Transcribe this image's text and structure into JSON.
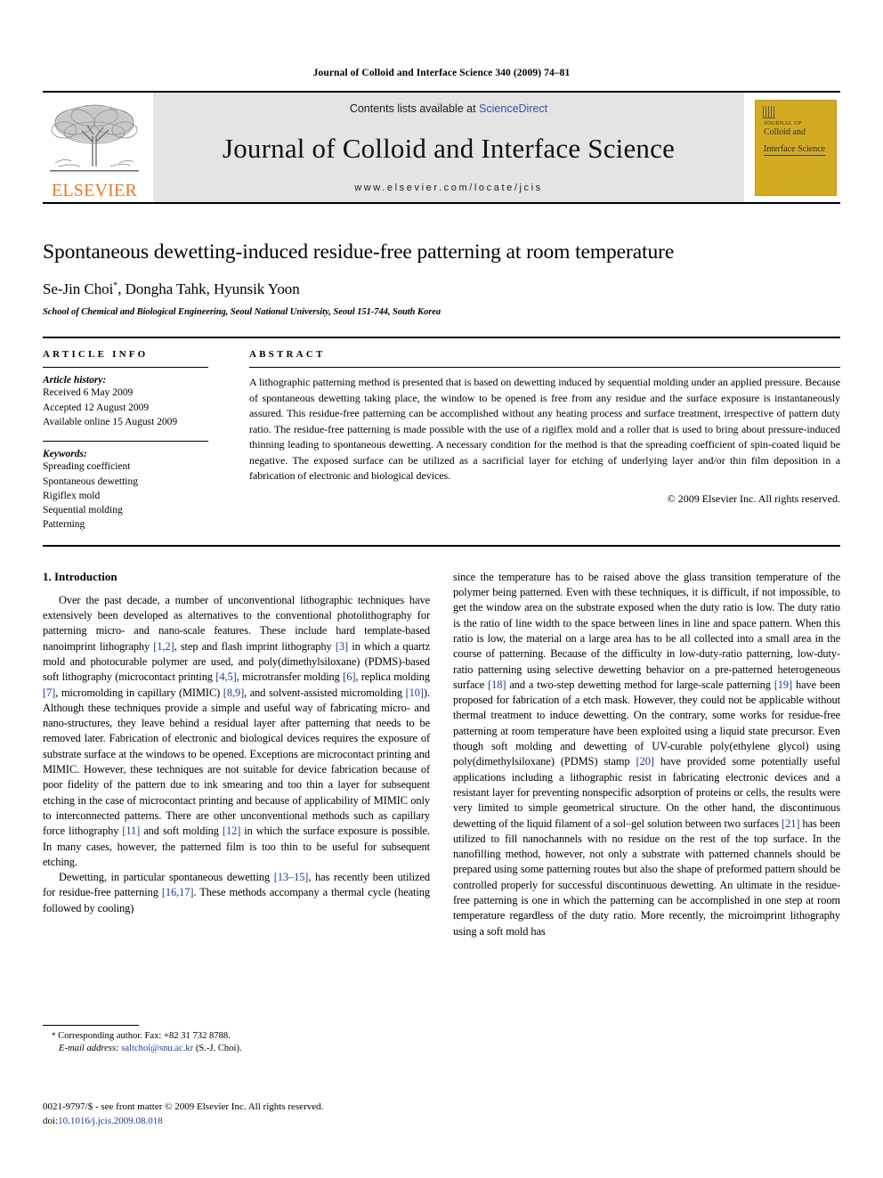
{
  "running_head": "Journal of Colloid and Interface Science 340 (2009) 74–81",
  "masthead": {
    "elsevier_wordmark": "ELSEVIER",
    "contents_prefix": "Contents lists available at ",
    "sciencedirect": "ScienceDirect",
    "journal_title": "Journal of Colloid and Interface Science",
    "journal_url": "www.elsevier.com/locate/jcis",
    "cover": {
      "line1": "JOURNAL OF",
      "line2": "Colloid and",
      "line3": "Interface Science",
      "background_color": "#d3ab22"
    },
    "banner_color": "#e4e4e4",
    "elsevier_orange": "#e87722"
  },
  "article": {
    "title": "Spontaneous dewetting-induced residue-free patterning at room temperature",
    "authors": "Se-Jin Choi",
    "authors_rest": ", Dongha Tahk, Hyunsik Yoon",
    "corresponding_marker": "*",
    "affiliation": "School of Chemical and Biological Engineering, Seoul National University, Seoul 151-744, South Korea"
  },
  "article_info": {
    "label": "ARTICLE INFO",
    "history_label": "Article history:",
    "history": [
      "Received 6 May 2009",
      "Accepted 12 August 2009",
      "Available online 15 August 2009"
    ],
    "keywords_label": "Keywords:",
    "keywords": [
      "Spreading coefficient",
      "Spontaneous dewetting",
      "Rigiflex mold",
      "Sequential molding",
      "Patterning"
    ]
  },
  "abstract": {
    "label": "ABSTRACT",
    "text": "A lithographic patterning method is presented that is based on dewetting induced by sequential molding under an applied pressure. Because of spontaneous dewetting taking place, the window to be opened is free from any residue and the surface exposure is instantaneously assured. This residue-free patterning can be accomplished without any heating process and surface treatment, irrespective of pattern duty ratio. The residue-free patterning is made possible with the use of a rigiflex mold and a roller that is used to bring about pressure-induced thinning leading to spontaneous dewetting. A necessary condition for the method is that the spreading coefficient of spin-coated liquid be negative. The exposed surface can be utilized as a sacrificial layer for etching of underlying layer and/or thin film deposition in a fabrication of electronic and biological devices.",
    "copyright": "© 2009 Elsevier Inc. All rights reserved."
  },
  "introduction": {
    "heading": "1. Introduction",
    "left_p1_a": "Over the past decade, a number of unconventional lithographic techniques have extensively been developed as alternatives to the conventional photolithography for patterning micro- and nano-scale features. These include hard template-based nanoimprint lithography ",
    "ref_1_2": "[1,2]",
    "left_p1_b": ", step and flash imprint lithography ",
    "ref_3": "[3]",
    "left_p1_c": " in which a quartz mold and photocurable polymer are used, and poly(dimethylsiloxane) (PDMS)-based soft lithography (microcontact printing ",
    "ref_4_5": "[4,5]",
    "left_p1_d": ", microtransfer molding ",
    "ref_6": "[6]",
    "left_p1_e": ", replica molding ",
    "ref_7": "[7]",
    "left_p1_f": ", micromolding in capillary (MIMIC) ",
    "ref_8_9": "[8,9]",
    "left_p1_g": ", and solvent-assisted micromolding ",
    "ref_10": "[10]",
    "left_p1_h": "). Although these techniques provide a simple and useful way of fabricating micro- and nano-structures, they leave behind a residual layer after patterning that needs to be removed later. Fabrication of electronic and biological devices requires the exposure of substrate surface at the windows to be opened. Exceptions are microcontact printing and MIMIC. However, these techniques are not suitable for device fabrication because of poor fidelity of the pattern due to ink smearing and too thin a layer for subsequent etching in the case of microcontact printing and because of applicability of MIMIC only to interconnected patterns. There are other unconventional methods such as capillary force lithography ",
    "ref_11": "[11]",
    "left_p1_i": " and soft molding ",
    "ref_12": "[12]",
    "left_p1_j": " in which the surface exposure is possible. In many cases, however, the patterned film is too thin to be useful for subsequent etching.",
    "left_p2_a": "Dewetting, in particular spontaneous dewetting ",
    "ref_13_15": "[13–15]",
    "left_p2_b": ", has recently been utilized for residue-free patterning ",
    "ref_16_17": "[16,17]",
    "left_p2_c": ". These methods accompany a thermal cycle (heating followed by cooling)",
    "right_p1_a": "since the temperature has to be raised above the glass transition temperature of the polymer being patterned. Even with these techniques, it is difficult, if not impossible, to get the window area on the substrate exposed when the duty ratio is low. The duty ratio is the ratio of line width to the space between lines in line and space pattern. When this ratio is low, the material on a large area has to be all collected into a small area in the course of patterning. Because of the difficulty in low-duty-ratio patterning, low-duty-ratio patterning using selective dewetting behavior on a pre-patterned heterogeneous surface ",
    "ref_18": "[18]",
    "right_p1_b": " and a two-step dewetting method for large-scale patterning ",
    "ref_19": "[19]",
    "right_p1_c": " have been proposed for fabrication of a etch mask. However, they could not be applicable without thermal treatment to induce dewetting. On the contrary, some works for residue-free patterning at room temperature have been exploited using a liquid state precursor. Even though soft molding and dewetting of UV-curable poly(ethylene glycol) using poly(dimethylsiloxane) (PDMS) stamp ",
    "ref_20": "[20]",
    "right_p1_d": " have provided some potentially useful applications including a lithographic resist in fabricating electronic devices and a resistant layer for preventing nonspecific adsorption of proteins or cells, the results were very limited to simple geometrical structure. On the other hand, the discontinuous dewetting of the liquid filament of a sol–gel solution between two surfaces ",
    "ref_21": "[21]",
    "right_p1_e": " has been utilized to fill nanochannels with no residue on the rest of the top surface. In the nanofilling method, however, not only a substrate with patterned channels should be prepared using some patterning routes but also the shape of preformed pattern should be controlled properly for successful discontinuous dewetting. An ultimate in the residue-free patterning is one in which the patterning can be accomplished in one step at room temperature regardless of the duty ratio. More recently, the microimprint lithography using a soft mold has"
  },
  "footnote": {
    "marker": "*",
    "corresponding": " Corresponding author. Fax: +82 31 732 8788.",
    "email_label": "E-mail address:",
    "email": "saltchoi@snu.ac.kr",
    "email_suffix": " (S.-J. Choi)."
  },
  "imprint": {
    "line1": "0021-9797/$ - see front matter © 2009 Elsevier Inc. All rights reserved.",
    "doi_label": "doi:",
    "doi_value": "10.1016/j.jcis.2009.08.018"
  }
}
